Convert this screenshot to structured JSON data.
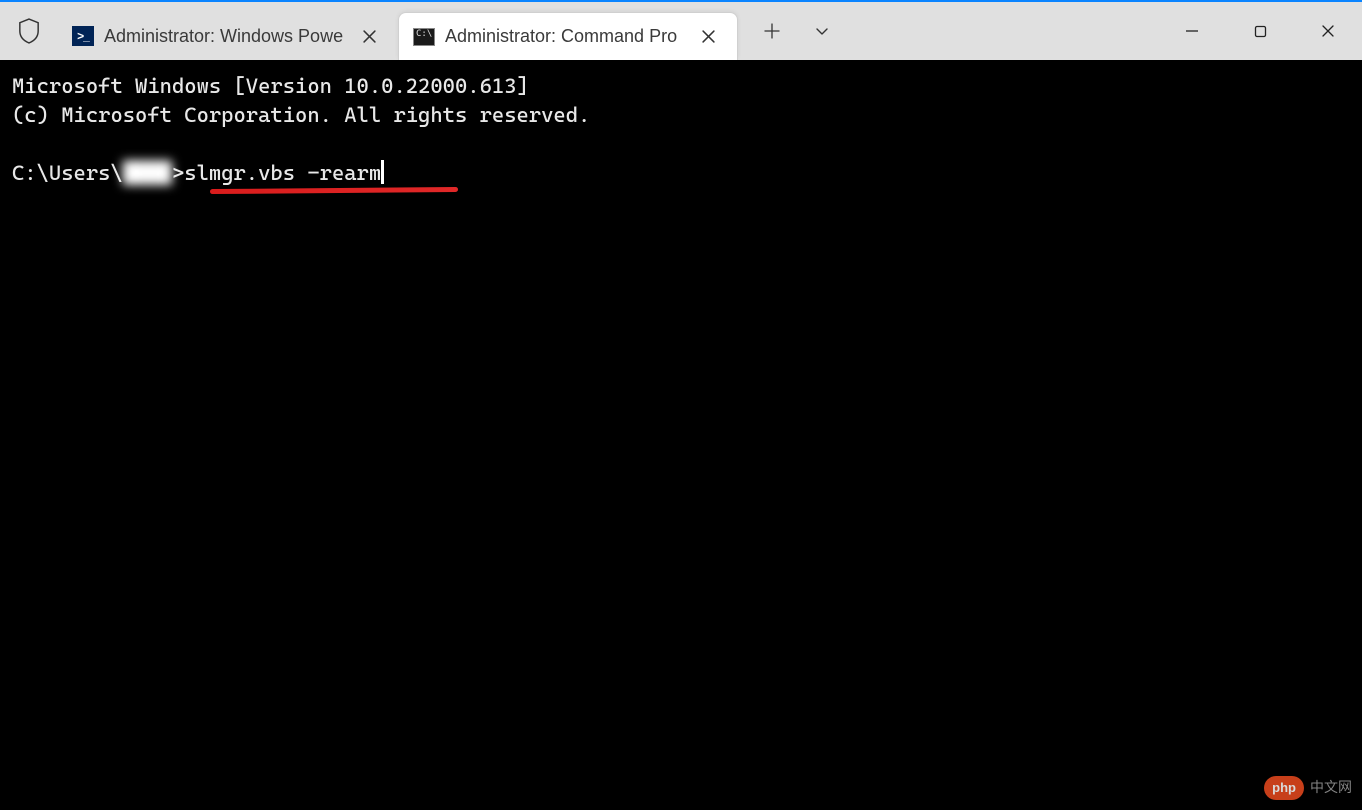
{
  "titlebar": {
    "tabs": [
      {
        "icon": "powershell",
        "label": "Administrator: Windows Powe",
        "active": false
      },
      {
        "icon": "cmd",
        "label": "Administrator: Command Pro",
        "active": true
      }
    ],
    "new_tab_tooltip": "New tab",
    "dropdown_tooltip": "Tab options"
  },
  "terminal": {
    "line1": "Microsoft Windows [Version 10.0.22000.613]",
    "line2": "(c) Microsoft Corporation. All rights reserved.",
    "prompt_prefix": "C:\\Users\\",
    "prompt_user_blurred": "████",
    "prompt_suffix": ">",
    "command": "slmgr.vbs -rearm"
  },
  "annotation": {
    "underline_color": "#d91c1c"
  },
  "watermark": {
    "badge": "php",
    "text": "中文网"
  }
}
